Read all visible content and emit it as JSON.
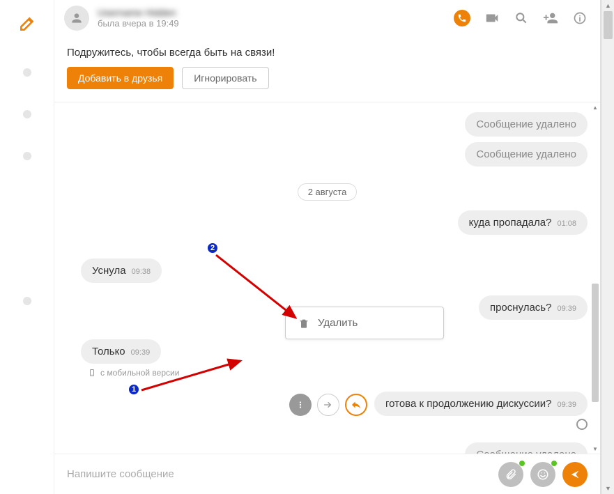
{
  "header": {
    "username": "Username Hidden",
    "status": "была вчера в 19:49"
  },
  "action_bar": {
    "title": "Подружитесь, чтобы всегда быть на связи!",
    "add_label": "Добавить в друзья",
    "ignore_label": "Игнорировать"
  },
  "date_separator": "2 августа",
  "messages": {
    "del1": "Сообщение удалено",
    "del2": "Сообщение удалено",
    "m1_text": "куда пропадала?",
    "m1_ts": "01:08",
    "m2_text": "Уснула",
    "m2_ts": "09:38",
    "m3_text": "проснулась?",
    "m3_ts": "09:39",
    "m4_text": "Только",
    "m4_ts": "09:39",
    "mobile_note": "с мобильной версии",
    "m5_text": "готова к продолжению дискуссии?",
    "m5_ts": "09:39",
    "del3": "Сообщение удалено"
  },
  "popup": {
    "delete_label": "Удалить"
  },
  "composer": {
    "placeholder": "Напишите сообщение"
  },
  "annotations": {
    "n1": "1",
    "n2": "2"
  }
}
